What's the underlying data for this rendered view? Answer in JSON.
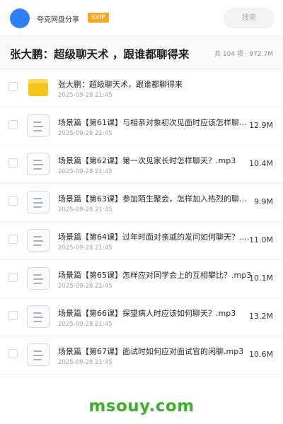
{
  "header": {
    "brand": "夸克网盘分享",
    "badge": "SVIP",
    "search_label": "搜索",
    "accent_color": "#2f7ff5",
    "badge_color": "#f5a623"
  },
  "folder": {
    "title": "张大鹏：超级聊天术 ，跟谁都聊得来",
    "stats": "共 104 项 · 972.7M"
  },
  "files": [
    {
      "name": "张大鹏：超级聊天术，跟谁都聊得来",
      "date": "2025-09-28 21:45",
      "size": "",
      "icon": "folder-icon"
    },
    {
      "name": "场景篇【第61课】与相亲对象初次见面时应该怎样聊天？.mp3",
      "date": "2025-09-28 21:45",
      "size": "12.9M",
      "icon": "audio-file-icon"
    },
    {
      "name": "场景篇【第62课】第一次见家长时怎样聊天？.mp3",
      "date": "2025-09-28 21:45",
      "size": "10.4M",
      "icon": "audio-file-icon"
    },
    {
      "name": "场景篇【第63课】参加陌生聚会，怎样加入热烈的聊天？.mp3",
      "date": "2025-09-28 21:45",
      "size": "9.9M",
      "icon": "audio-file-icon"
    },
    {
      "name": "场景篇【第64课】过年时面对亲戚的发问如何聊天？.mp3",
      "date": "2025-09-28 21:45",
      "size": "11.0M",
      "icon": "audio-file-icon"
    },
    {
      "name": "场景篇【第65课】怎样应对同学会上的互相攀比？.mp3",
      "date": "2025-09-28 21:45",
      "size": "10.1M",
      "icon": "audio-file-icon"
    },
    {
      "name": "场景篇【第66课】探望病人时应该如何聊天？.mp3",
      "date": "2025-09-28 21:45",
      "size": "13.2M",
      "icon": "audio-file-icon"
    },
    {
      "name": "场景篇【第67课】面试时如何应对面试官的闲聊.mp3",
      "date": "2025-09-28 21:45",
      "size": "10.6M",
      "icon": "audio-file-icon"
    }
  ],
  "watermark": "msouy.com"
}
